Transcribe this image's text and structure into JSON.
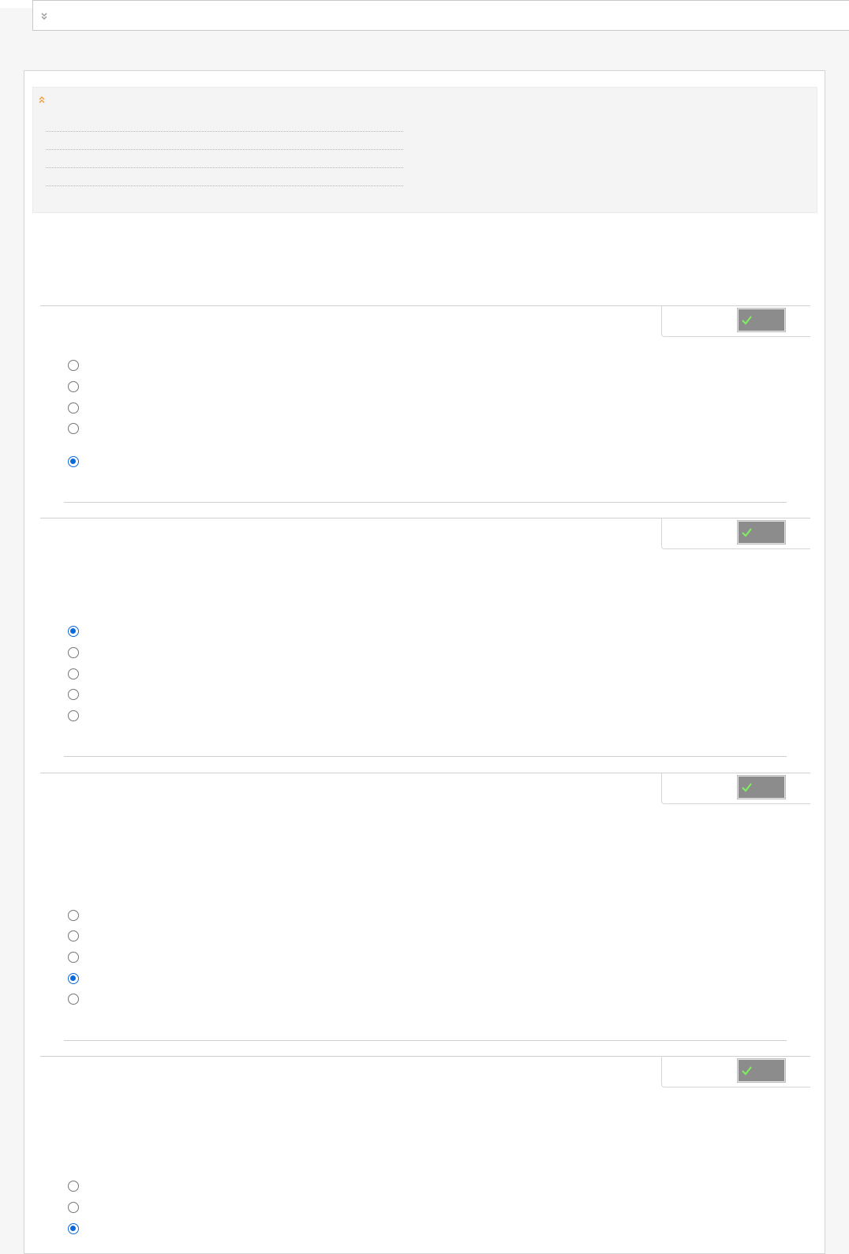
{
  "page": {
    "background": "#f6f6f6",
    "frame_background": "#ffffff",
    "accent_color": "#0b6ad9",
    "icon_color_orange": "#f0a040",
    "check_button_color": "#8c8c8c",
    "check_icon_color": "#7cf25a"
  },
  "header": {
    "expand_icon": "chevron-double-down-icon"
  },
  "info_panel": {
    "collapse_icon": "chevron-double-up-icon",
    "lines": [
      "",
      "",
      "",
      ""
    ]
  },
  "questions": [
    {
      "check_icon": "checkmark-icon",
      "option_count": 5,
      "selected_index": 4
    },
    {
      "check_icon": "checkmark-icon",
      "option_count": 5,
      "selected_index": 0
    },
    {
      "check_icon": "checkmark-icon",
      "option_count": 5,
      "selected_index": 3
    },
    {
      "check_icon": "checkmark-icon",
      "option_count": 3,
      "selected_index": 2
    }
  ]
}
